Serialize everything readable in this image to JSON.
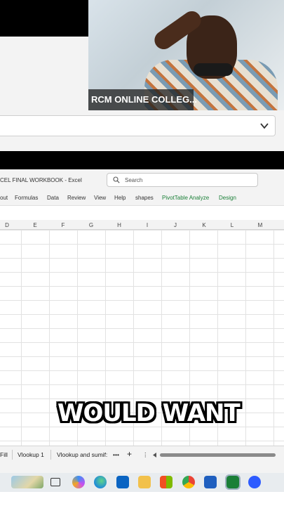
{
  "video": {
    "participant_name": "RCM ONLINE COLLEG..."
  },
  "excel": {
    "window_title": "CEL FINAL WORKBOOK  -  Excel",
    "search_placeholder": "Search",
    "ribbon_tabs": [
      "out",
      "Formulas",
      "Data",
      "Review",
      "View",
      "Help",
      "shapes"
    ],
    "context_tabs": [
      "PivotTable Analyze",
      "Design"
    ],
    "columns": [
      "D",
      "E",
      "F",
      "G",
      "H",
      "I",
      "J",
      "K",
      "L",
      "M"
    ],
    "sheet_tabs": [
      "Fill",
      "Vlookup 1",
      "Vlookup and sumif:"
    ],
    "more_sheets": "•••",
    "add_sheet": "+",
    "options": "⋮"
  },
  "caption": "WOULD WANT",
  "colors": {
    "excel_green": "#1a7f37",
    "chrome": "#f3f3f3"
  },
  "taskbar_icons": [
    "widgets-icon",
    "task-view-icon",
    "copilot-icon",
    "edge-icon",
    "outlook-icon",
    "file-explorer-icon",
    "store-icon",
    "chrome-icon",
    "word-icon",
    "excel-icon",
    "zoom-icon"
  ]
}
